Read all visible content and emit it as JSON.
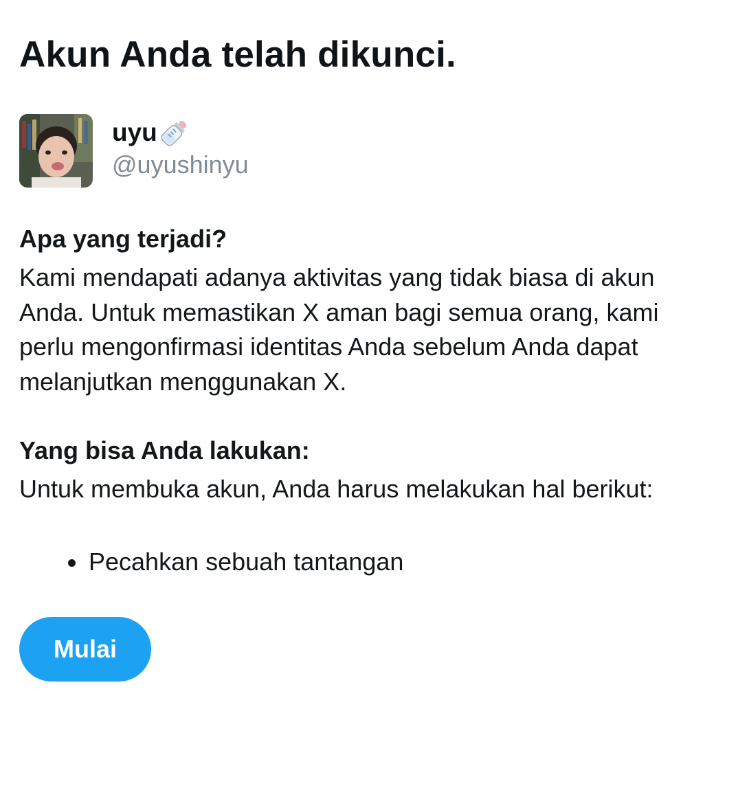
{
  "title": "Akun Anda telah dikunci.",
  "account": {
    "display_name": "uyu",
    "name_emoji": "baby-bottle-icon",
    "handle": "@uyushinyu"
  },
  "what_happened": {
    "heading": "Apa yang terjadi?",
    "lines": [
      "Kami mendapati adanya aktivitas yang tidak biasa di akun",
      "Anda. Untuk memastikan X aman bagi semua orang, kami",
      "perlu mengonfirmasi identitas Anda sebelum Anda dapat",
      "melanjutkan menggunakan X."
    ]
  },
  "what_you_can_do": {
    "heading": "Yang bisa Anda lakukan:",
    "text": "Untuk membuka akun, Anda harus melakukan hal berikut:",
    "steps": [
      "Pecahkan sebuah tantangan"
    ]
  },
  "start_button": {
    "label": "Mulai",
    "color": "#1da1f2"
  },
  "colors": {
    "text": "#14171a",
    "secondary_text": "#7f8b96",
    "background": "#ffffff"
  }
}
